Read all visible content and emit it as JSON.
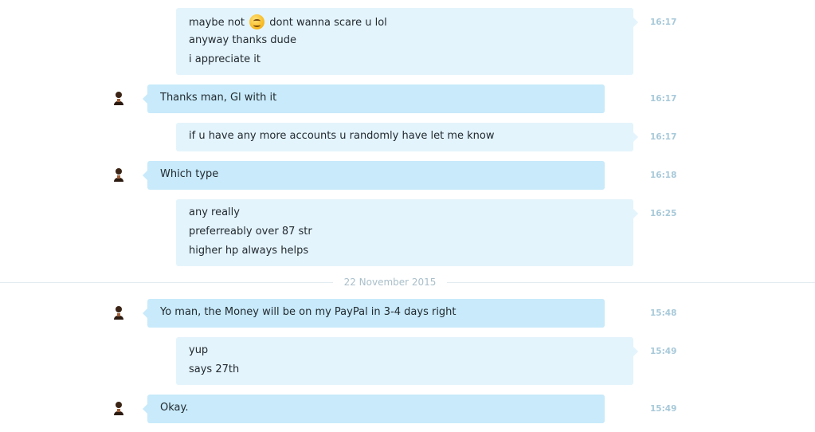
{
  "messages": [
    {
      "dir": "out",
      "time": "16:17",
      "lines": [
        "maybe not",
        "anyway thanks dude",
        "i appreciate it"
      ],
      "line0_after_emoji": "dont wanna scare u lol",
      "emoji": "smiling-face-icon"
    },
    {
      "dir": "in",
      "time": "16:17",
      "lines": [
        "Thanks man, Gl with it"
      ]
    },
    {
      "dir": "out",
      "time": "16:17",
      "lines": [
        "if u have any more accounts u randomly have let me know"
      ]
    },
    {
      "dir": "in",
      "time": "16:18",
      "lines": [
        "Which type"
      ]
    },
    {
      "dir": "out",
      "time": "16:25",
      "lines": [
        "any really",
        "preferreably over 87 str",
        "higher hp always helps"
      ]
    },
    {
      "dir": "in",
      "time": "15:48",
      "lines": [
        "Yo man, the Money will be on my PayPal in 3-4 days right"
      ]
    },
    {
      "dir": "out",
      "time": "15:49",
      "lines": [
        "yup",
        "says 27th"
      ]
    },
    {
      "dir": "in",
      "time": "15:49",
      "lines": [
        "Okay."
      ]
    }
  ],
  "date_divider": "22 November 2015",
  "colors": {
    "incoming_bubble": "#c8eafa",
    "outgoing_bubble": "#e4f4fc",
    "timestamp": "#a7c9d9",
    "divider_text": "#a9bfca"
  },
  "icons": {
    "avatar": "user-avatar-icon"
  }
}
